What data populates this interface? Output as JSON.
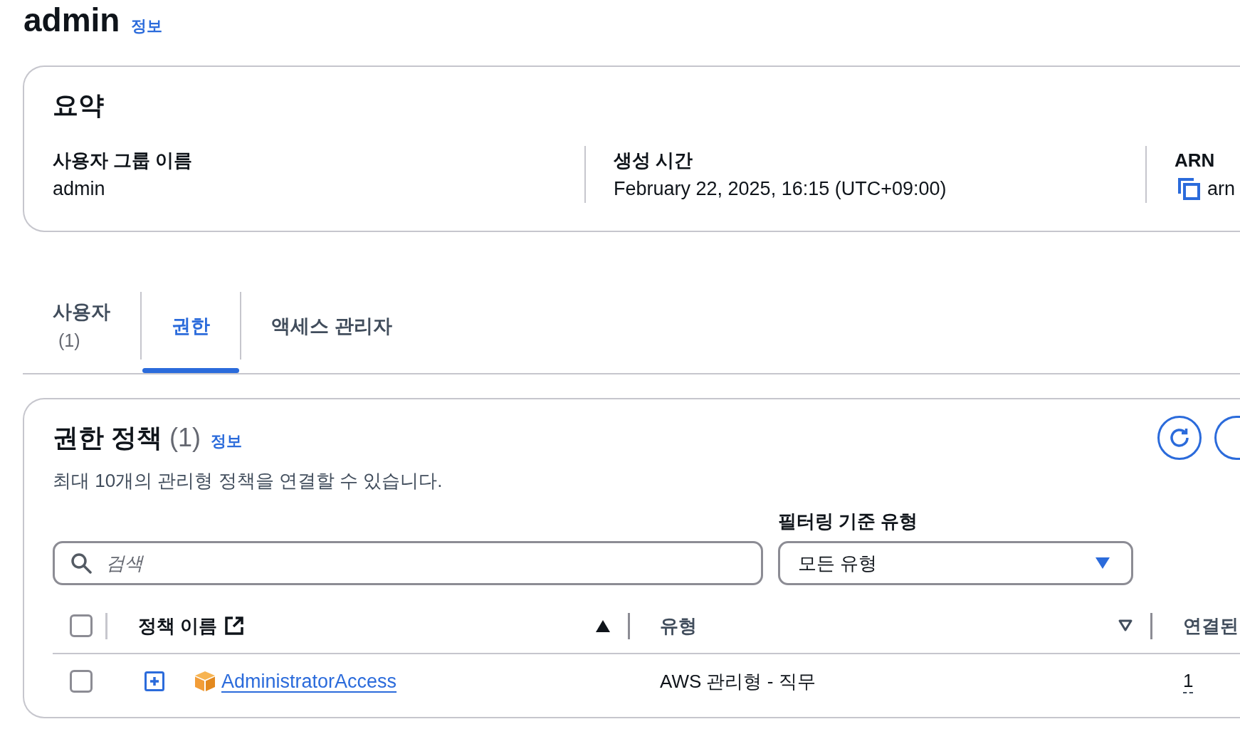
{
  "header": {
    "title": "admin",
    "info_link": "정보"
  },
  "summary": {
    "title": "요약",
    "fields": [
      {
        "label": "사용자 그룹 이름",
        "value": "admin",
        "kind": "text"
      },
      {
        "label": "생성 시간",
        "value": "February 22, 2025, 16:15 (UTC+09:00)",
        "kind": "text"
      },
      {
        "label": "ARN",
        "value": "arn",
        "kind": "copyable"
      }
    ]
  },
  "tabs": [
    {
      "label": "사용자",
      "count": "(1)",
      "selected": false
    },
    {
      "label": "권한",
      "selected": true
    },
    {
      "label": "액세스 관리자",
      "selected": false
    }
  ],
  "permissions": {
    "title": "권한 정책",
    "count": "(1)",
    "info_link": "정보",
    "description": "최대 10개의 관리형 정책을 연결할 수 있습니다.",
    "actions": [
      {
        "kind": "icon"
      },
      {
        "kind": "clipped"
      }
    ],
    "search": {
      "placeholder": "검색"
    },
    "filter": {
      "label": "필터링 기준 유형",
      "value": "모든 유형"
    },
    "table": {
      "select_all": {
        "checked": false
      },
      "columns": [
        {
          "label": "정책 이름",
          "external_link": true,
          "sortable": true,
          "sorted": true
        },
        {
          "label": "유형",
          "external_link": false,
          "sortable": true,
          "sorted": false
        },
        {
          "label": "연결된",
          "external_link": false,
          "sortable": false
        }
      ],
      "rows": [
        {
          "selected": false,
          "expanded": false,
          "policy_name": "AdministratorAccess",
          "type": "AWS 관리형 - 직무",
          "attached": "1"
        }
      ]
    }
  }
}
